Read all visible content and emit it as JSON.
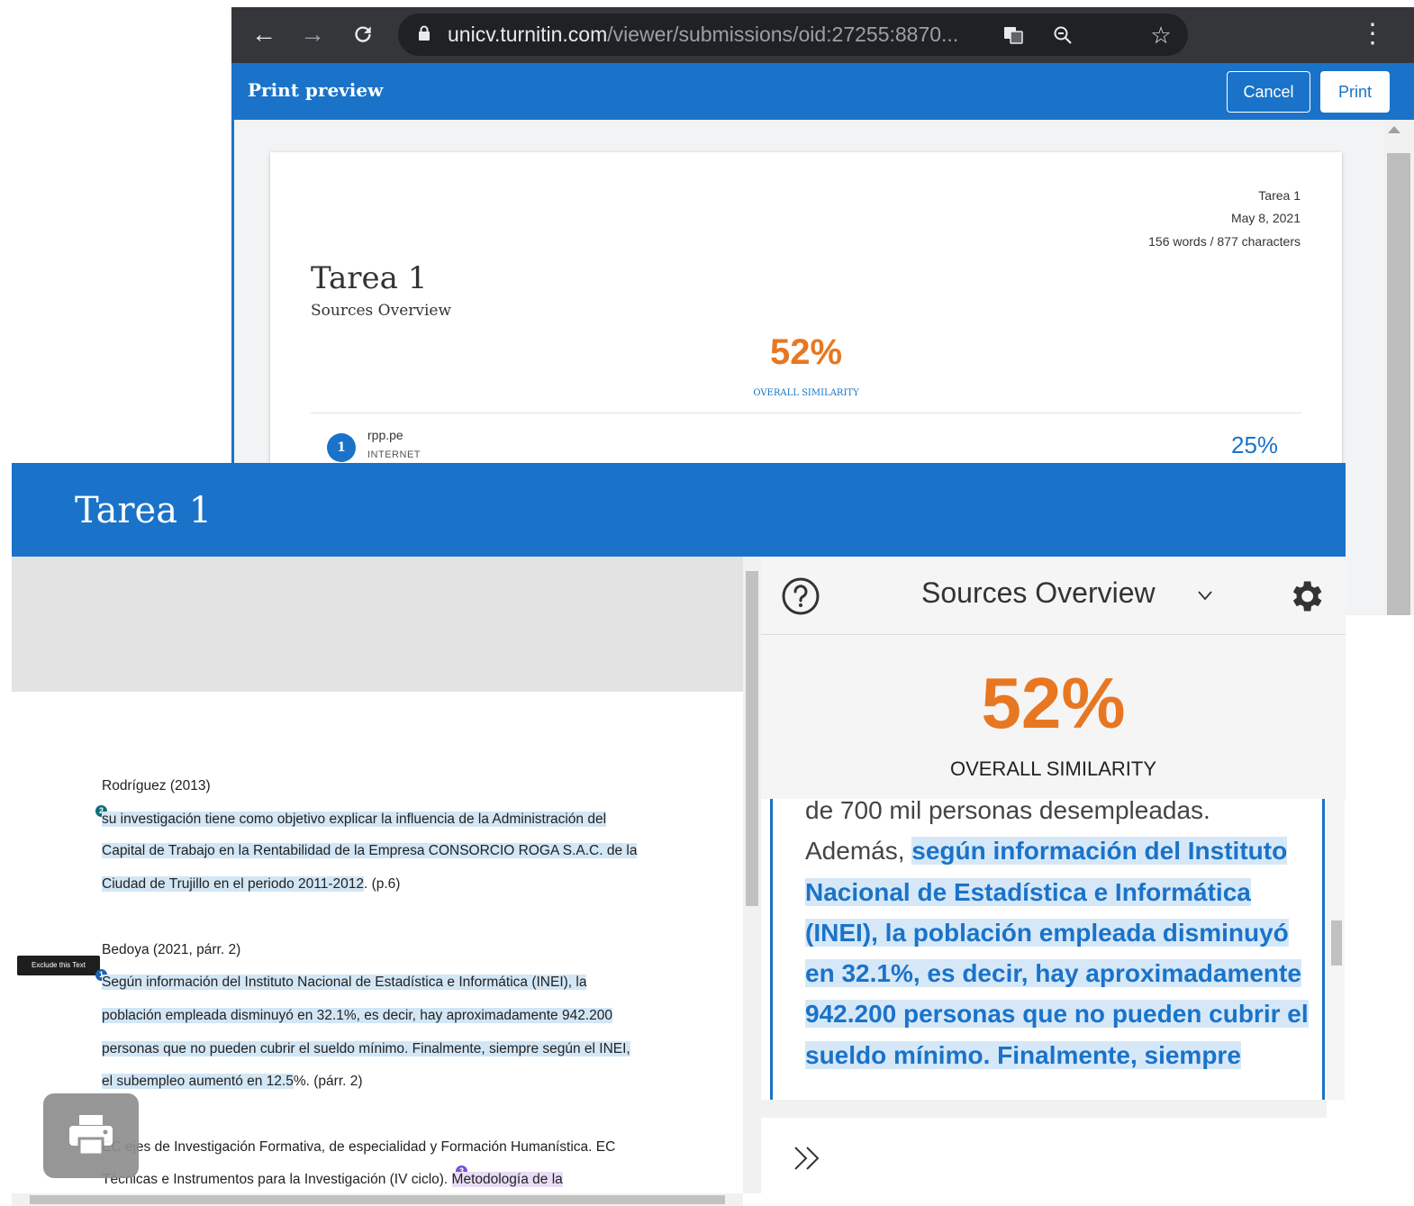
{
  "browser": {
    "url_host": "unicv.turnitin.com",
    "url_path": "/viewer/submissions/oid:27255:8870...",
    "icons": [
      "back-icon",
      "forward-icon",
      "reload-icon",
      "lock-icon",
      "translate-icon",
      "zoom-icon",
      "star-icon",
      "menu-icon"
    ]
  },
  "print_preview": {
    "title": "Print preview",
    "cancel_label": "Cancel",
    "print_label": "Print",
    "page": {
      "meta_title": "Tarea 1",
      "meta_date": "May 8, 2021",
      "meta_counts": "156 words / 877 characters",
      "title": "Tarea 1",
      "subtitle": "Sources Overview",
      "similarity": "52%",
      "similarity_label": "OVERALL SIMILARITY",
      "source": {
        "number": "1",
        "name": "rpp.pe",
        "type": "INTERNET",
        "percent": "25%"
      }
    }
  },
  "viewer": {
    "title": "Tarea 1",
    "exclude_tooltip": "Exclude this Text",
    "document": {
      "cite_1": "Rodríguez (2013)",
      "block_1": [
        "su investigación tiene como objetivo explicar la influencia de la Administración del",
        "Capital de Trabajo en la Rentabilidad de la Empresa CONSORCIO ROGA S.A.C. de la"
      ],
      "block_1_last_hl": "Ciudad de Trujillo en el periodo 2011-2012",
      "block_1_last_rest": ". (p.6)",
      "cite_2": "Bedoya (2021, párr. 2)",
      "block_2": [
        "Según información del Instituto Nacional de Estadística e Informática (INEI), la",
        "población empleada disminuyó en 32.1%, es decir, hay aproximadamente 942.200",
        "personas que no pueden cubrir el sueldo mínimo. Finalmente, siempre según el INEI,"
      ],
      "block_2_last_hl": "el subempleo aumentó en 12.5",
      "block_2_last_rest": "%. (párr. 2)",
      "block_3_line_1": "EC ejes de Investigación Formativa, de especialidad y Formación Humanística. EC",
      "block_3_line_2": "Técnicas e Instrumentos para la Investigación (IV ciclo). ",
      "block_3_line_2_hl": "Metodología de la",
      "markers": {
        "m2": "2",
        "m1": "1",
        "m3": "3"
      }
    },
    "panel": {
      "title": "Sources Overview",
      "similarity": "52%",
      "similarity_label": "OVERALL SIMILARITY",
      "excerpt_plain_1": "de 700 mil personas desempleadas. Además, ",
      "excerpt_match": "según información del Instituto Nacional de Estadística e Informática (INEI), la población empleada disminuyó en 32.1%, es decir, hay aproximadamente 942.200 personas que no pueden cubrir el sueldo mínimo. Finalmente, siempre"
    }
  },
  "colors": {
    "brand_blue": "#1a73c9",
    "similarity_orange": "#e87722",
    "match_highlight": "#d2e6f5"
  }
}
